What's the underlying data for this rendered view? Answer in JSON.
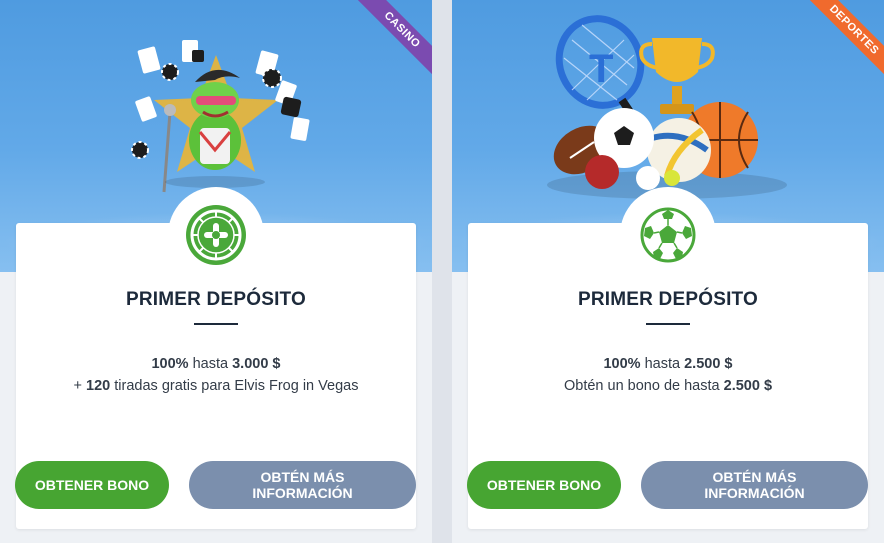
{
  "cards": [
    {
      "ribbon": "CASINO",
      "title": "PRIMER DEPÓSITO",
      "line1_pct": "100%",
      "line1_mid": " hasta ",
      "line1_amount": "3.000 $",
      "line2_prefix": "+ ",
      "line2_bold": "120",
      "line2_rest": " tiradas gratis para Elvis Frog in Vegas",
      "primary_button": "OBTENER BONO",
      "secondary_button": "OBTÉN MÁS INFORMACIÓN"
    },
    {
      "ribbon": "DEPORTES",
      "title": "PRIMER DEPÓSITO",
      "line1_pct": "100%",
      "line1_mid": " hasta ",
      "line1_amount": "2.500 $",
      "line2_prefix": "Obtén un bono de hasta ",
      "line2_bold": "2.500 $",
      "line2_rest": "",
      "primary_button": "OBTENER BONO",
      "secondary_button": "OBTÉN MÁS INFORMACIÓN"
    }
  ],
  "icons": {
    "casino_badge": "roulette-icon",
    "sports_badge": "soccer-ball-icon",
    "casino_illustration": "elvis-frog-illustration",
    "sports_illustration": "sports-balls-illustration"
  },
  "colors": {
    "primary_button": "#47a532",
    "secondary_button": "#7b8fad",
    "casino_ribbon": "#7b4bb0",
    "sports_ribbon": "#f06a2d",
    "hero_blue": "#4f9be0"
  }
}
